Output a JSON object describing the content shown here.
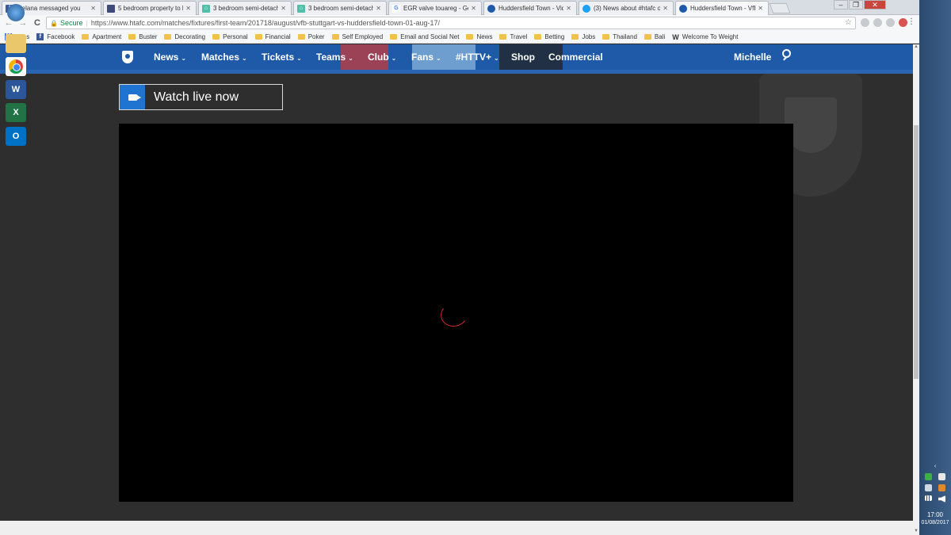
{
  "tabs": [
    {
      "title": "Melana messaged you",
      "icon": "facebook-icon",
      "color": "#3b5998"
    },
    {
      "title": "5 bedroom property to let",
      "icon": "site-icon",
      "color": "#3d4a7a"
    },
    {
      "title": "3 bedroom semi-detache",
      "icon": "house-icon",
      "color": "#4fbfa8"
    },
    {
      "title": "3 bedroom semi-detache",
      "icon": "house-icon",
      "color": "#4fbfa8"
    },
    {
      "title": "EGR valve touareg - Goo",
      "icon": "google-icon",
      "color": "#4285f4"
    },
    {
      "title": "Huddersfield Town - Vide",
      "icon": "crest-icon",
      "color": "#1f5aa8"
    },
    {
      "title": "(3) News about #htafc or",
      "icon": "twitter-icon",
      "color": "#1da1f2"
    },
    {
      "title": "Huddersfield Town - VfB",
      "icon": "crest-icon",
      "color": "#1f5aa8"
    }
  ],
  "window": {
    "minimize": "–",
    "maximize": "❐",
    "close": "✕"
  },
  "toolbar": {
    "back": "←",
    "forward": "→",
    "reload": "C",
    "secure_label": "Secure",
    "url": "https://www.htafc.com/matches/fixtures/first-team/201718/august/vfb-stuttgart-vs-huddersfield-town-01-aug-17/",
    "star": "☆",
    "menu": "⋮"
  },
  "bookmarks": [
    {
      "label": "Apps",
      "icon": "apps-grid-icon"
    },
    {
      "label": "Facebook",
      "icon": "facebook-icon"
    },
    {
      "label": "Apartment",
      "icon": "folder-icon"
    },
    {
      "label": "Buster",
      "icon": "folder-icon"
    },
    {
      "label": "Decorating",
      "icon": "folder-icon"
    },
    {
      "label": "Personal",
      "icon": "folder-icon"
    },
    {
      "label": "Financial",
      "icon": "folder-icon"
    },
    {
      "label": "Poker",
      "icon": "folder-icon"
    },
    {
      "label": "Self Employed",
      "icon": "folder-icon"
    },
    {
      "label": "Email and Social Net",
      "icon": "folder-icon"
    },
    {
      "label": "News",
      "icon": "folder-icon"
    },
    {
      "label": "Travel",
      "icon": "folder-icon"
    },
    {
      "label": "Betting",
      "icon": "folder-icon"
    },
    {
      "label": "Jobs",
      "icon": "folder-icon"
    },
    {
      "label": "Thailand",
      "icon": "folder-icon"
    },
    {
      "label": "Bali",
      "icon": "folder-icon"
    },
    {
      "label": "Welcome To Weight",
      "icon": "ww-icon"
    }
  ],
  "site_nav": {
    "items": [
      {
        "label": "News",
        "has_dropdown": true
      },
      {
        "label": "Matches",
        "has_dropdown": true
      },
      {
        "label": "Tickets",
        "has_dropdown": true
      },
      {
        "label": "Teams",
        "has_dropdown": true
      },
      {
        "label": "Club",
        "has_dropdown": true
      },
      {
        "label": "Fans",
        "has_dropdown": true
      },
      {
        "label": "#HTTV+",
        "has_dropdown": true
      },
      {
        "label": "Shop",
        "has_dropdown": false
      },
      {
        "label": "Commercial",
        "has_dropdown": false
      }
    ],
    "user": "Michelle",
    "chevron": "⌄",
    "brand_color": "#1f5aa8"
  },
  "watch_live": {
    "label": "Watch live now",
    "icon": "video-camera-icon",
    "accent": "#1f73d1"
  },
  "video": {
    "state": "loading",
    "spinner_color": "#d32a2a"
  },
  "taskbar": {
    "apps": [
      "start-orb-icon",
      "file-explorer-icon",
      "chrome-icon",
      "word-icon",
      "excel-icon",
      "outlook-icon"
    ],
    "word_letter": "W",
    "excel_letter": "X",
    "outlook_letter": "O",
    "tray_arrow": "‹",
    "clock": "17:00",
    "date": "01/08/2017"
  }
}
